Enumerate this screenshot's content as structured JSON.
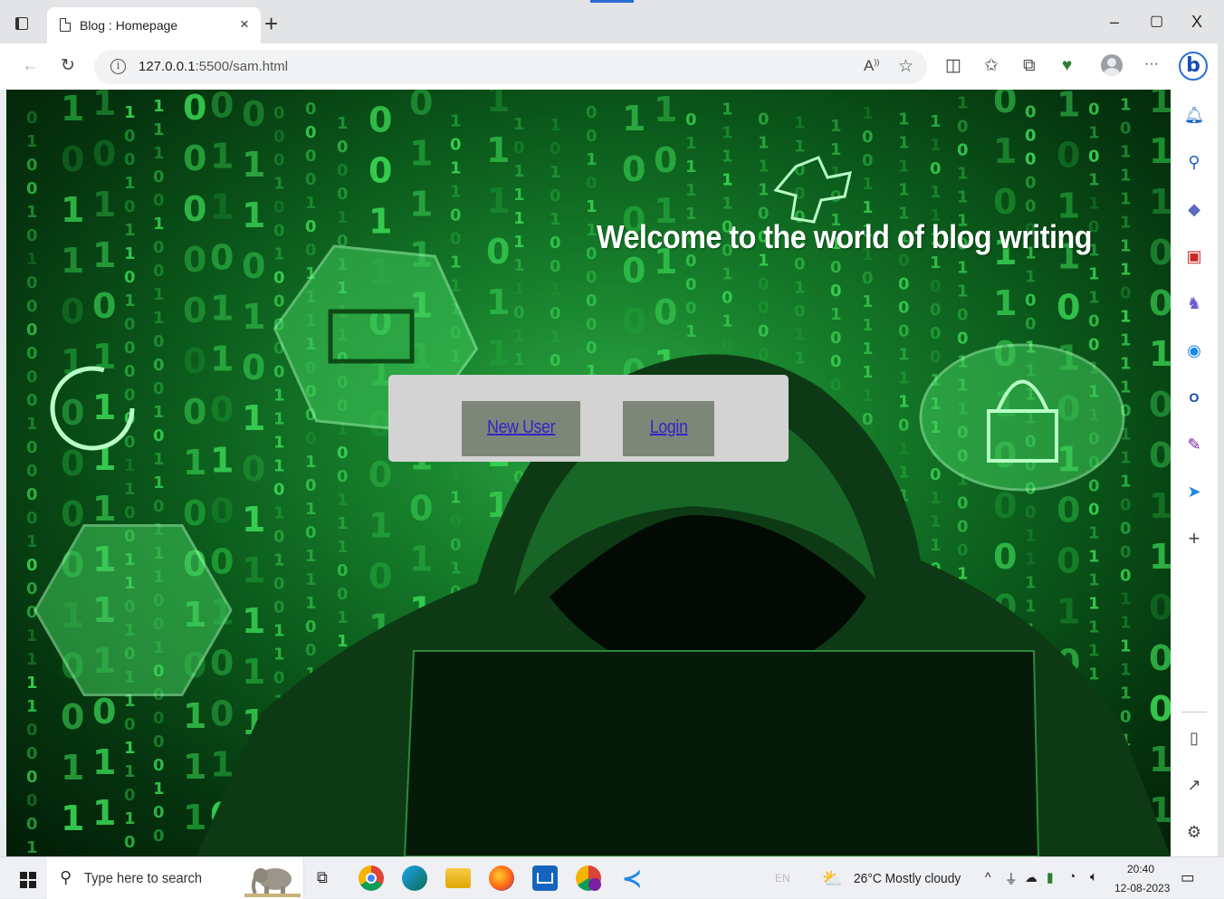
{
  "browser": {
    "tab_title": "Blog : Homepage",
    "tab_close": "×",
    "new_tab": "+",
    "url_host": "127.0.0.1",
    "url_rest": ":5500/sam.html",
    "window_controls": {
      "minimize": "–",
      "restore": "▢",
      "close": "X"
    },
    "more_menu": "···"
  },
  "page": {
    "heading": "Welcome to the world of blog writing",
    "buttons": {
      "new_user": "New User",
      "login": "Login"
    },
    "colors": {
      "nav_box": "#d3d3d3",
      "button_bg": "#7d8679",
      "link": "#3422c8",
      "heading": "#ffffff"
    }
  },
  "sidebar": {
    "items": [
      "bell-icon",
      "search-icon",
      "tag-icon",
      "briefcase-icon",
      "chess-icon",
      "office-icon",
      "outlook-icon",
      "designer-icon",
      "send-icon"
    ],
    "add": "+"
  },
  "taskbar": {
    "search_placeholder": "Type here to search",
    "language": "EN",
    "weather": "26°C  Mostly cloudy",
    "time": "20:40",
    "date": "12-08-2023"
  }
}
